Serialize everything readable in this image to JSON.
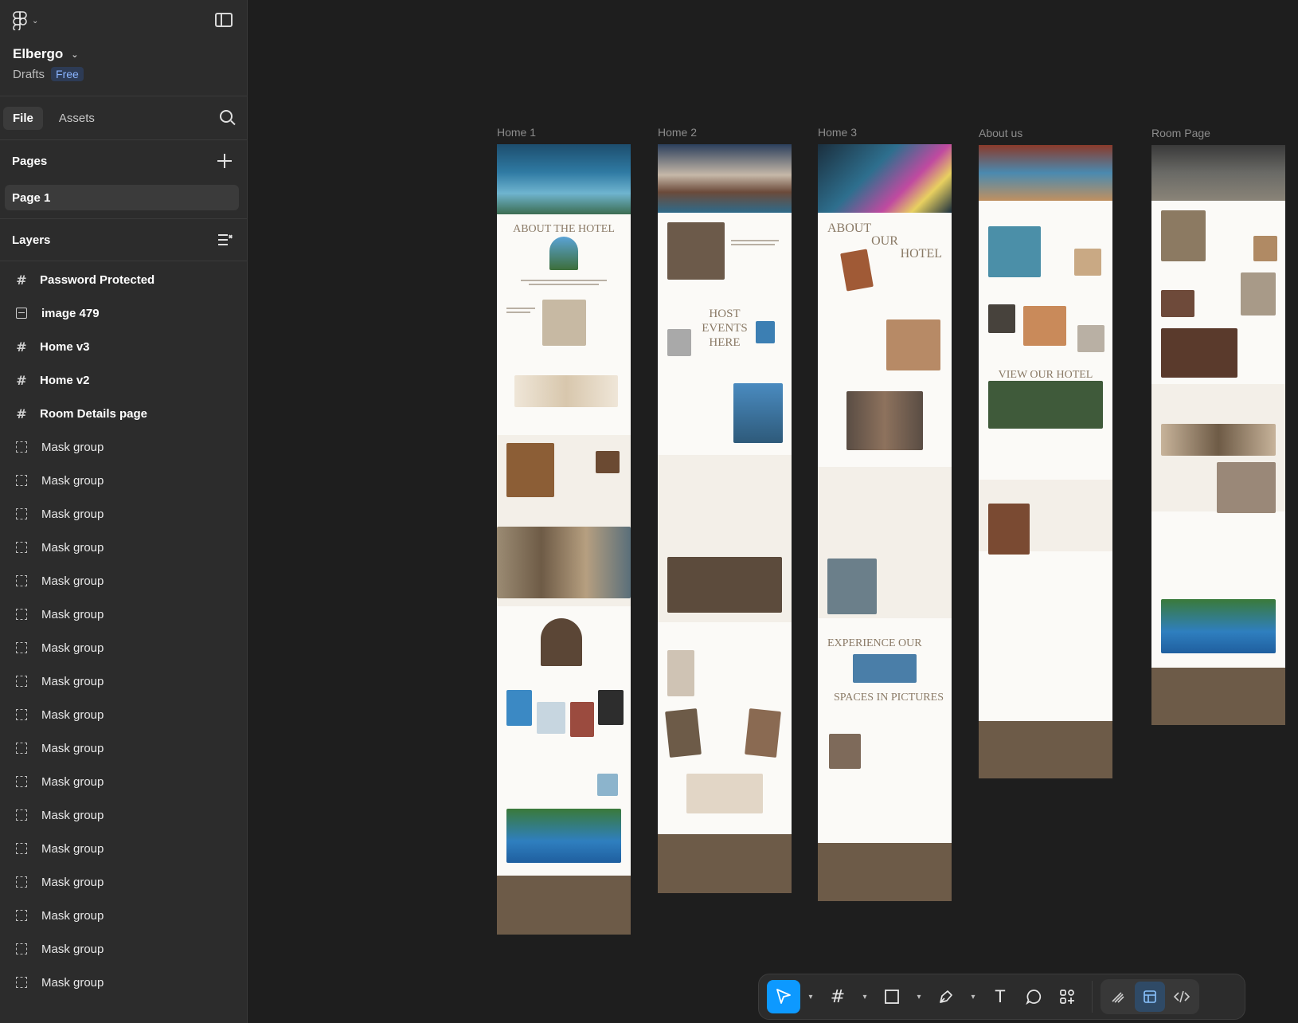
{
  "sidebar": {
    "project_name": "Elbergo",
    "location": "Drafts",
    "plan_badge": "Free",
    "tabs": [
      {
        "label": "File"
      },
      {
        "label": "Assets"
      }
    ],
    "pages_title": "Pages",
    "pages": [
      {
        "label": "Page 1"
      }
    ],
    "layers_title": "Layers",
    "layers": [
      {
        "label": "Password Protected",
        "type": "frame"
      },
      {
        "label": "image 479",
        "type": "image"
      },
      {
        "label": "Home v3",
        "type": "frame"
      },
      {
        "label": "Home v2",
        "type": "frame"
      },
      {
        "label": "Room Details page",
        "type": "frame"
      },
      {
        "label": "Mask group",
        "type": "mask"
      },
      {
        "label": "Mask group",
        "type": "mask"
      },
      {
        "label": "Mask group",
        "type": "mask"
      },
      {
        "label": "Mask group",
        "type": "mask"
      },
      {
        "label": "Mask group",
        "type": "mask"
      },
      {
        "label": "Mask group",
        "type": "mask"
      },
      {
        "label": "Mask group",
        "type": "mask"
      },
      {
        "label": "Mask group",
        "type": "mask"
      },
      {
        "label": "Mask group",
        "type": "mask"
      },
      {
        "label": "Mask group",
        "type": "mask"
      },
      {
        "label": "Mask group",
        "type": "mask"
      },
      {
        "label": "Mask group",
        "type": "mask"
      },
      {
        "label": "Mask group",
        "type": "mask"
      },
      {
        "label": "Mask group",
        "type": "mask"
      },
      {
        "label": "Mask group",
        "type": "mask"
      },
      {
        "label": "Mask group",
        "type": "mask"
      },
      {
        "label": "Mask group",
        "type": "mask"
      }
    ]
  },
  "canvas": {
    "frames": [
      {
        "label": "Home 1",
        "headings": [
          "ABOUT THE HOTEL"
        ]
      },
      {
        "label": "Home 2",
        "headings": [
          "HOST",
          "EVENTS",
          "HERE"
        ]
      },
      {
        "label": "Home 3",
        "headings": [
          "ABOUT",
          "OUR",
          "HOTEL",
          "EXPERIENCE OUR",
          "SPACES IN PICTURES"
        ]
      },
      {
        "label": "About us",
        "headings": [
          "VIEW OUR HOTEL"
        ]
      },
      {
        "label": "Room Page",
        "headings": []
      }
    ]
  },
  "toolbar": {
    "tools": [
      {
        "name": "move-tool-icon",
        "glyph": "➤",
        "active": true
      },
      {
        "name": "frame-tool-icon",
        "glyph": "#",
        "active": false
      },
      {
        "name": "rectangle-tool-icon",
        "glyph": "□",
        "active": false
      },
      {
        "name": "pen-tool-icon",
        "glyph": "✒",
        "active": false
      },
      {
        "name": "text-tool-icon",
        "glyph": "T",
        "active": false
      },
      {
        "name": "comment-tool-icon",
        "glyph": "◯",
        "active": false
      },
      {
        "name": "actions-tool-icon",
        "glyph": "⁘",
        "active": false
      }
    ],
    "modes": [
      {
        "name": "draw-mode-icon",
        "glyph": "✎"
      },
      {
        "name": "design-mode-icon",
        "glyph": "▤"
      },
      {
        "name": "dev-mode-icon",
        "glyph": "</>"
      }
    ]
  },
  "colors": {
    "canvas_bg": "#1e1e1e",
    "sidebar_bg": "#2c2c2c",
    "accent": "#0d99ff",
    "footer_brown": "#6d5b48"
  }
}
